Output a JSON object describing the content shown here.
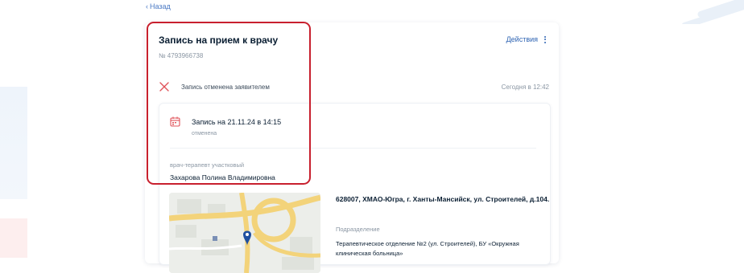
{
  "nav": {
    "back_label": "Назад"
  },
  "appointment": {
    "title": "Запись на прием к врачу",
    "number": "№ 4793966738",
    "actions_label": "Действия",
    "status": {
      "text": "Запись отменена заявителем",
      "time": "Сегодня в 12:42"
    },
    "details": {
      "appointment_text": "Запись на 21.11.24 в 14:15",
      "appointment_status": "отменена",
      "specialty": "врач-терапевт участковый",
      "doctor": "Захарова Полина Владимировна"
    },
    "location": {
      "address": "628007, ХМАО-Югра, г. Ханты-Мансийск, ул. Строителей, д.104.",
      "subdivision_label": "Подразделение",
      "subdivision": "Терапевтическое отделение №2 (ул. Строителей), БУ «Окружная клиническая больница»"
    }
  },
  "colors": {
    "accent": "#2e64b3",
    "cancel": "#e0535a",
    "highlight": "#c8202e",
    "marker": "#1f4fa0"
  },
  "icons": {
    "back": "chevron-left-icon",
    "actions": "more-vertical-icon",
    "status": "close-icon",
    "appointment": "calendar-icon",
    "map_marker": "map-marker-icon"
  }
}
